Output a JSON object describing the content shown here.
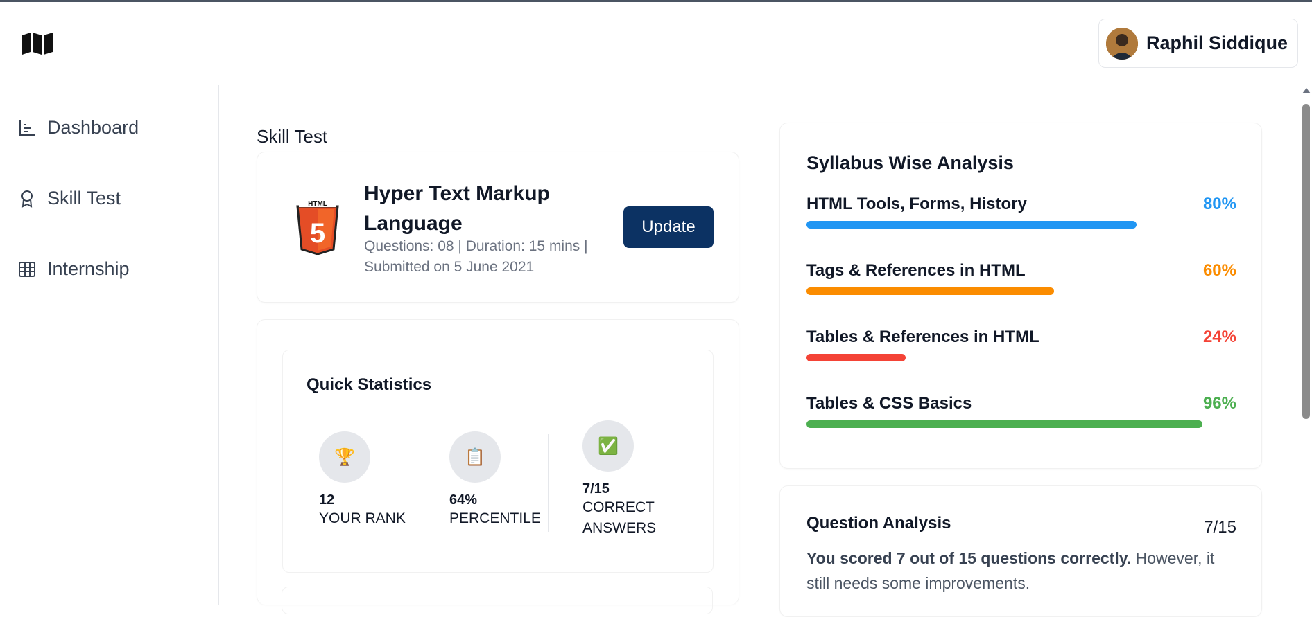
{
  "header": {
    "logo_icon": "map-icon",
    "user_name": "Raphil Siddique"
  },
  "sidebar": {
    "items": [
      {
        "label": "Dashboard",
        "icon": "chart-icon"
      },
      {
        "label": "Skill Test",
        "icon": "badge-icon"
      },
      {
        "label": "Internship",
        "icon": "table-icon"
      }
    ]
  },
  "main": {
    "page_title": "Skill Test",
    "test": {
      "title": "Hyper Text Markup Language",
      "meta": "Questions: 08 | Duration: 15 mins | Submitted on 5 June 2021",
      "update_label": "Update",
      "icon": "html5-icon"
    },
    "quick_stats": {
      "title": "Quick Statistics",
      "items": [
        {
          "icon": "🏆",
          "value": "12",
          "label": "YOUR RANK"
        },
        {
          "icon": "📋",
          "value": "64%",
          "label": "PERCENTILE"
        },
        {
          "icon": "✅",
          "value": "7/15",
          "label": "CORRECT ANSWERS"
        }
      ]
    }
  },
  "syllabus": {
    "title": "Syllabus Wise Analysis",
    "topics": [
      {
        "name": "HTML Tools, Forms, History",
        "percent_label": "80%",
        "percent": 80,
        "color": "#2196f3"
      },
      {
        "name": "Tags & References in HTML",
        "percent_label": "60%",
        "percent": 60,
        "color": "#fb8c00"
      },
      {
        "name": "Tables & References in HTML",
        "percent_label": "24%",
        "percent": 24,
        "color": "#f44336"
      },
      {
        "name": "Tables & CSS Basics",
        "percent_label": "96%",
        "percent": 96,
        "color": "#4caf50"
      }
    ]
  },
  "question_analysis": {
    "title": "Question Analysis",
    "count": "7/15",
    "summary_bold": "You scored 7 out of 15 questions correctly.",
    "summary_rest": " However, it still needs some improvements."
  }
}
